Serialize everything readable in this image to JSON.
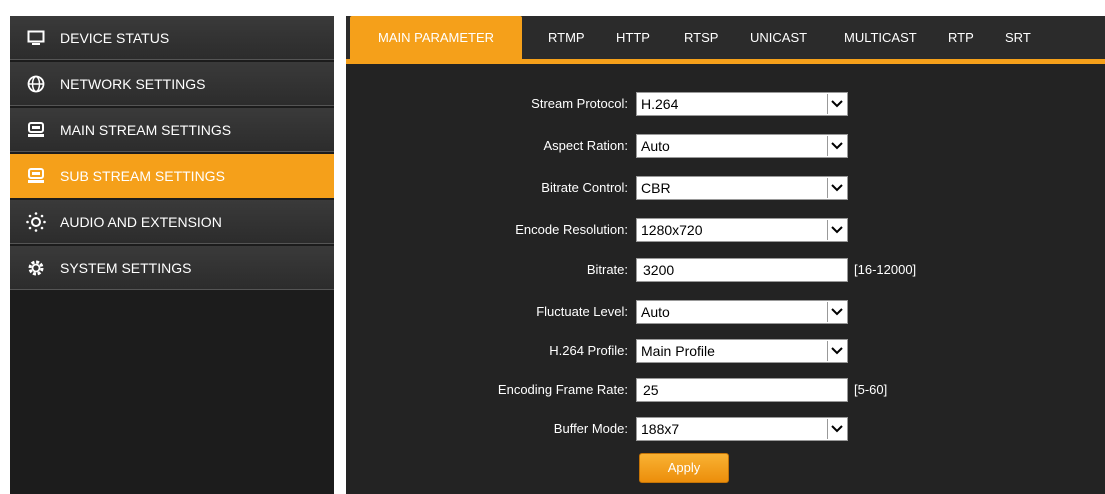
{
  "sidebar": {
    "items": [
      {
        "label": "DEVICE STATUS",
        "icon": "monitor-icon"
      },
      {
        "label": "NETWORK SETTINGS",
        "icon": "globe-icon"
      },
      {
        "label": "MAIN STREAM SETTINGS",
        "icon": "stream-icon"
      },
      {
        "label": "SUB STREAM SETTINGS",
        "icon": "stream-icon",
        "active": true
      },
      {
        "label": "AUDIO AND EXTENSION",
        "icon": "audio-icon"
      },
      {
        "label": "SYSTEM SETTINGS",
        "icon": "gear-icon"
      }
    ]
  },
  "tabs": [
    "MAIN PARAMETER",
    "RTMP",
    "HTTP",
    "RTSP",
    "UNICAST",
    "MULTICAST",
    "RTP",
    "SRT"
  ],
  "form": {
    "stream_protocol": {
      "label": "Stream Protocol:",
      "value": "H.264"
    },
    "aspect_ratio": {
      "label": "Aspect Ration:",
      "value": "Auto"
    },
    "bitrate_control": {
      "label": "Bitrate Control:",
      "value": "CBR"
    },
    "encode_resolution": {
      "label": "Encode Resolution:",
      "value": "1280x720"
    },
    "bitrate": {
      "label": "Bitrate:",
      "value": "3200",
      "range": "[16-12000]"
    },
    "fluctuate_level": {
      "label": "Fluctuate Level:",
      "value": "Auto"
    },
    "h264_profile": {
      "label": "H.264 Profile:",
      "value": "Main Profile"
    },
    "encoding_frame_rate": {
      "label": "Encoding Frame Rate:",
      "value": "25",
      "range": "[5-60]"
    },
    "buffer_mode": {
      "label": "Buffer Mode:",
      "value": "188x7"
    },
    "apply_label": "Apply"
  },
  "colors": {
    "accent": "#f5a01a",
    "panel": "#232323",
    "sidebar": "#2c2c2c"
  }
}
